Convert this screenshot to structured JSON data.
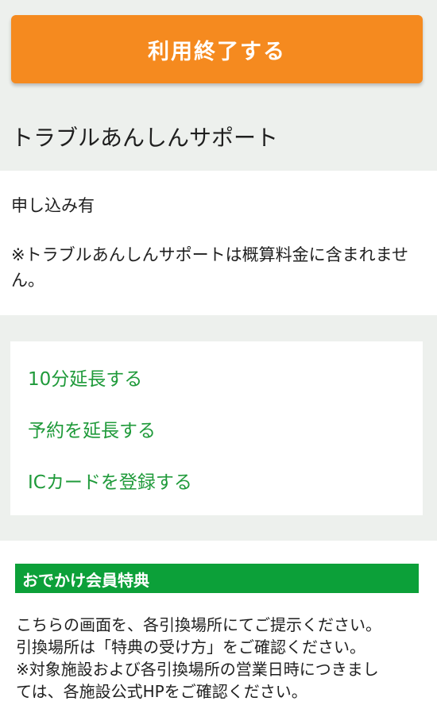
{
  "end_button": {
    "label": "利用終了する"
  },
  "trouble_support": {
    "heading": "トラブルあんしんサポート",
    "status": "申し込み有",
    "note": "※トラブルあんしんサポートは概算料金に含まれません。"
  },
  "actions": [
    {
      "label": "10分延長する"
    },
    {
      "label": "予約を延長する"
    },
    {
      "label": "ICカードを登録する"
    }
  ],
  "member_benefits": {
    "title": "おでかけ会員特典",
    "lines": [
      "こちらの画面を、各引換場所にてご提示ください。",
      "引換場所は「特典の受け方」をご確認ください。",
      "※対象施設および各引換場所の営業日時につきまし",
      "ては、各施設公式HPをご確認ください。"
    ]
  },
  "colors": {
    "accent_orange": "#f58a1f",
    "link_green": "#1f9a3a",
    "header_green": "#0ca039",
    "background": "#edf0ed"
  }
}
